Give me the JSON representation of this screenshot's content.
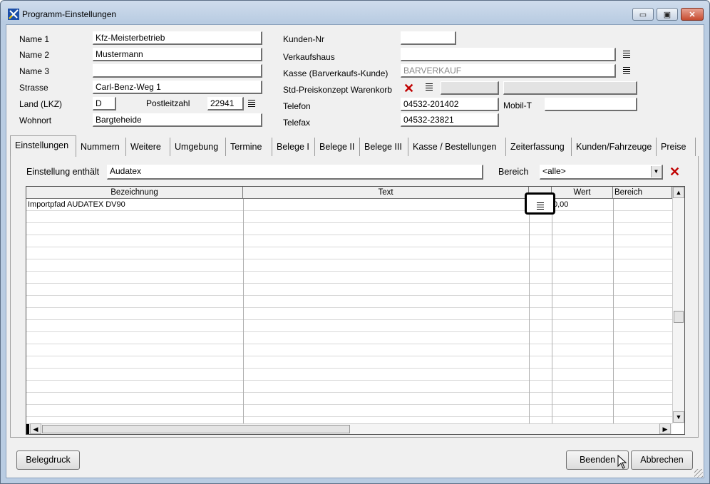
{
  "window": {
    "title": "Programm-Einstellungen",
    "min_glyph": "▭",
    "max_glyph": "▣",
    "close_glyph": "✕"
  },
  "company": {
    "name1_label": "Name 1",
    "name1": "Kfz-Meisterbetrieb",
    "name2_label": "Name 2",
    "name2": "Mustermann",
    "name3_label": "Name 3",
    "name3": "",
    "street_label": "Strasse",
    "street": "Carl-Benz-Weg 1",
    "country_label": "Land (LKZ)",
    "country": "D",
    "zip_label": "Postleitzahl",
    "zip": "22941",
    "city_label": "Wohnort",
    "city": "Bargteheide"
  },
  "customer": {
    "kundennr_label": "Kunden-Nr",
    "kundennr": "",
    "verkaufshaus_label": "Verkaufshaus",
    "verkaufshaus": "",
    "kasse_label": "Kasse (Barverkaufs-Kunde)",
    "kasse": "BARVERKAUF",
    "preiskonzept_label": "Std-Preiskonzept Warenkorb",
    "telefon_label": "Telefon",
    "telefon": "04532-201402",
    "mobil_label": "Mobil-T",
    "mobil": "",
    "telefax_label": "Telefax",
    "telefax": "04532-23821"
  },
  "tabs": [
    "Einstellungen",
    "Nummern",
    "Weitere",
    "Umgebung",
    "Termine",
    "Belege I",
    "Belege II",
    "Belege III",
    "Kasse / Bestellungen",
    "Zeiterfassung",
    "Kunden/Fahrzeuge",
    "Preise"
  ],
  "active_tab": "Einstellungen",
  "filter": {
    "label": "Einstellung enthält",
    "value": "Audatex",
    "bereich_label": "Bereich",
    "bereich_value": "<alle>"
  },
  "grid": {
    "columns": [
      "Bezeichnung",
      "Text",
      "",
      "Wert",
      "Bereich"
    ],
    "rows": [
      {
        "bezeichnung": "Importpfad AUDATEX DV90",
        "text": "",
        "wert": "0,00",
        "bereich": ""
      }
    ]
  },
  "buttons": {
    "belegdruck": "Belegdruck",
    "beenden": "Beenden",
    "abbrechen": "Abbrechen"
  }
}
